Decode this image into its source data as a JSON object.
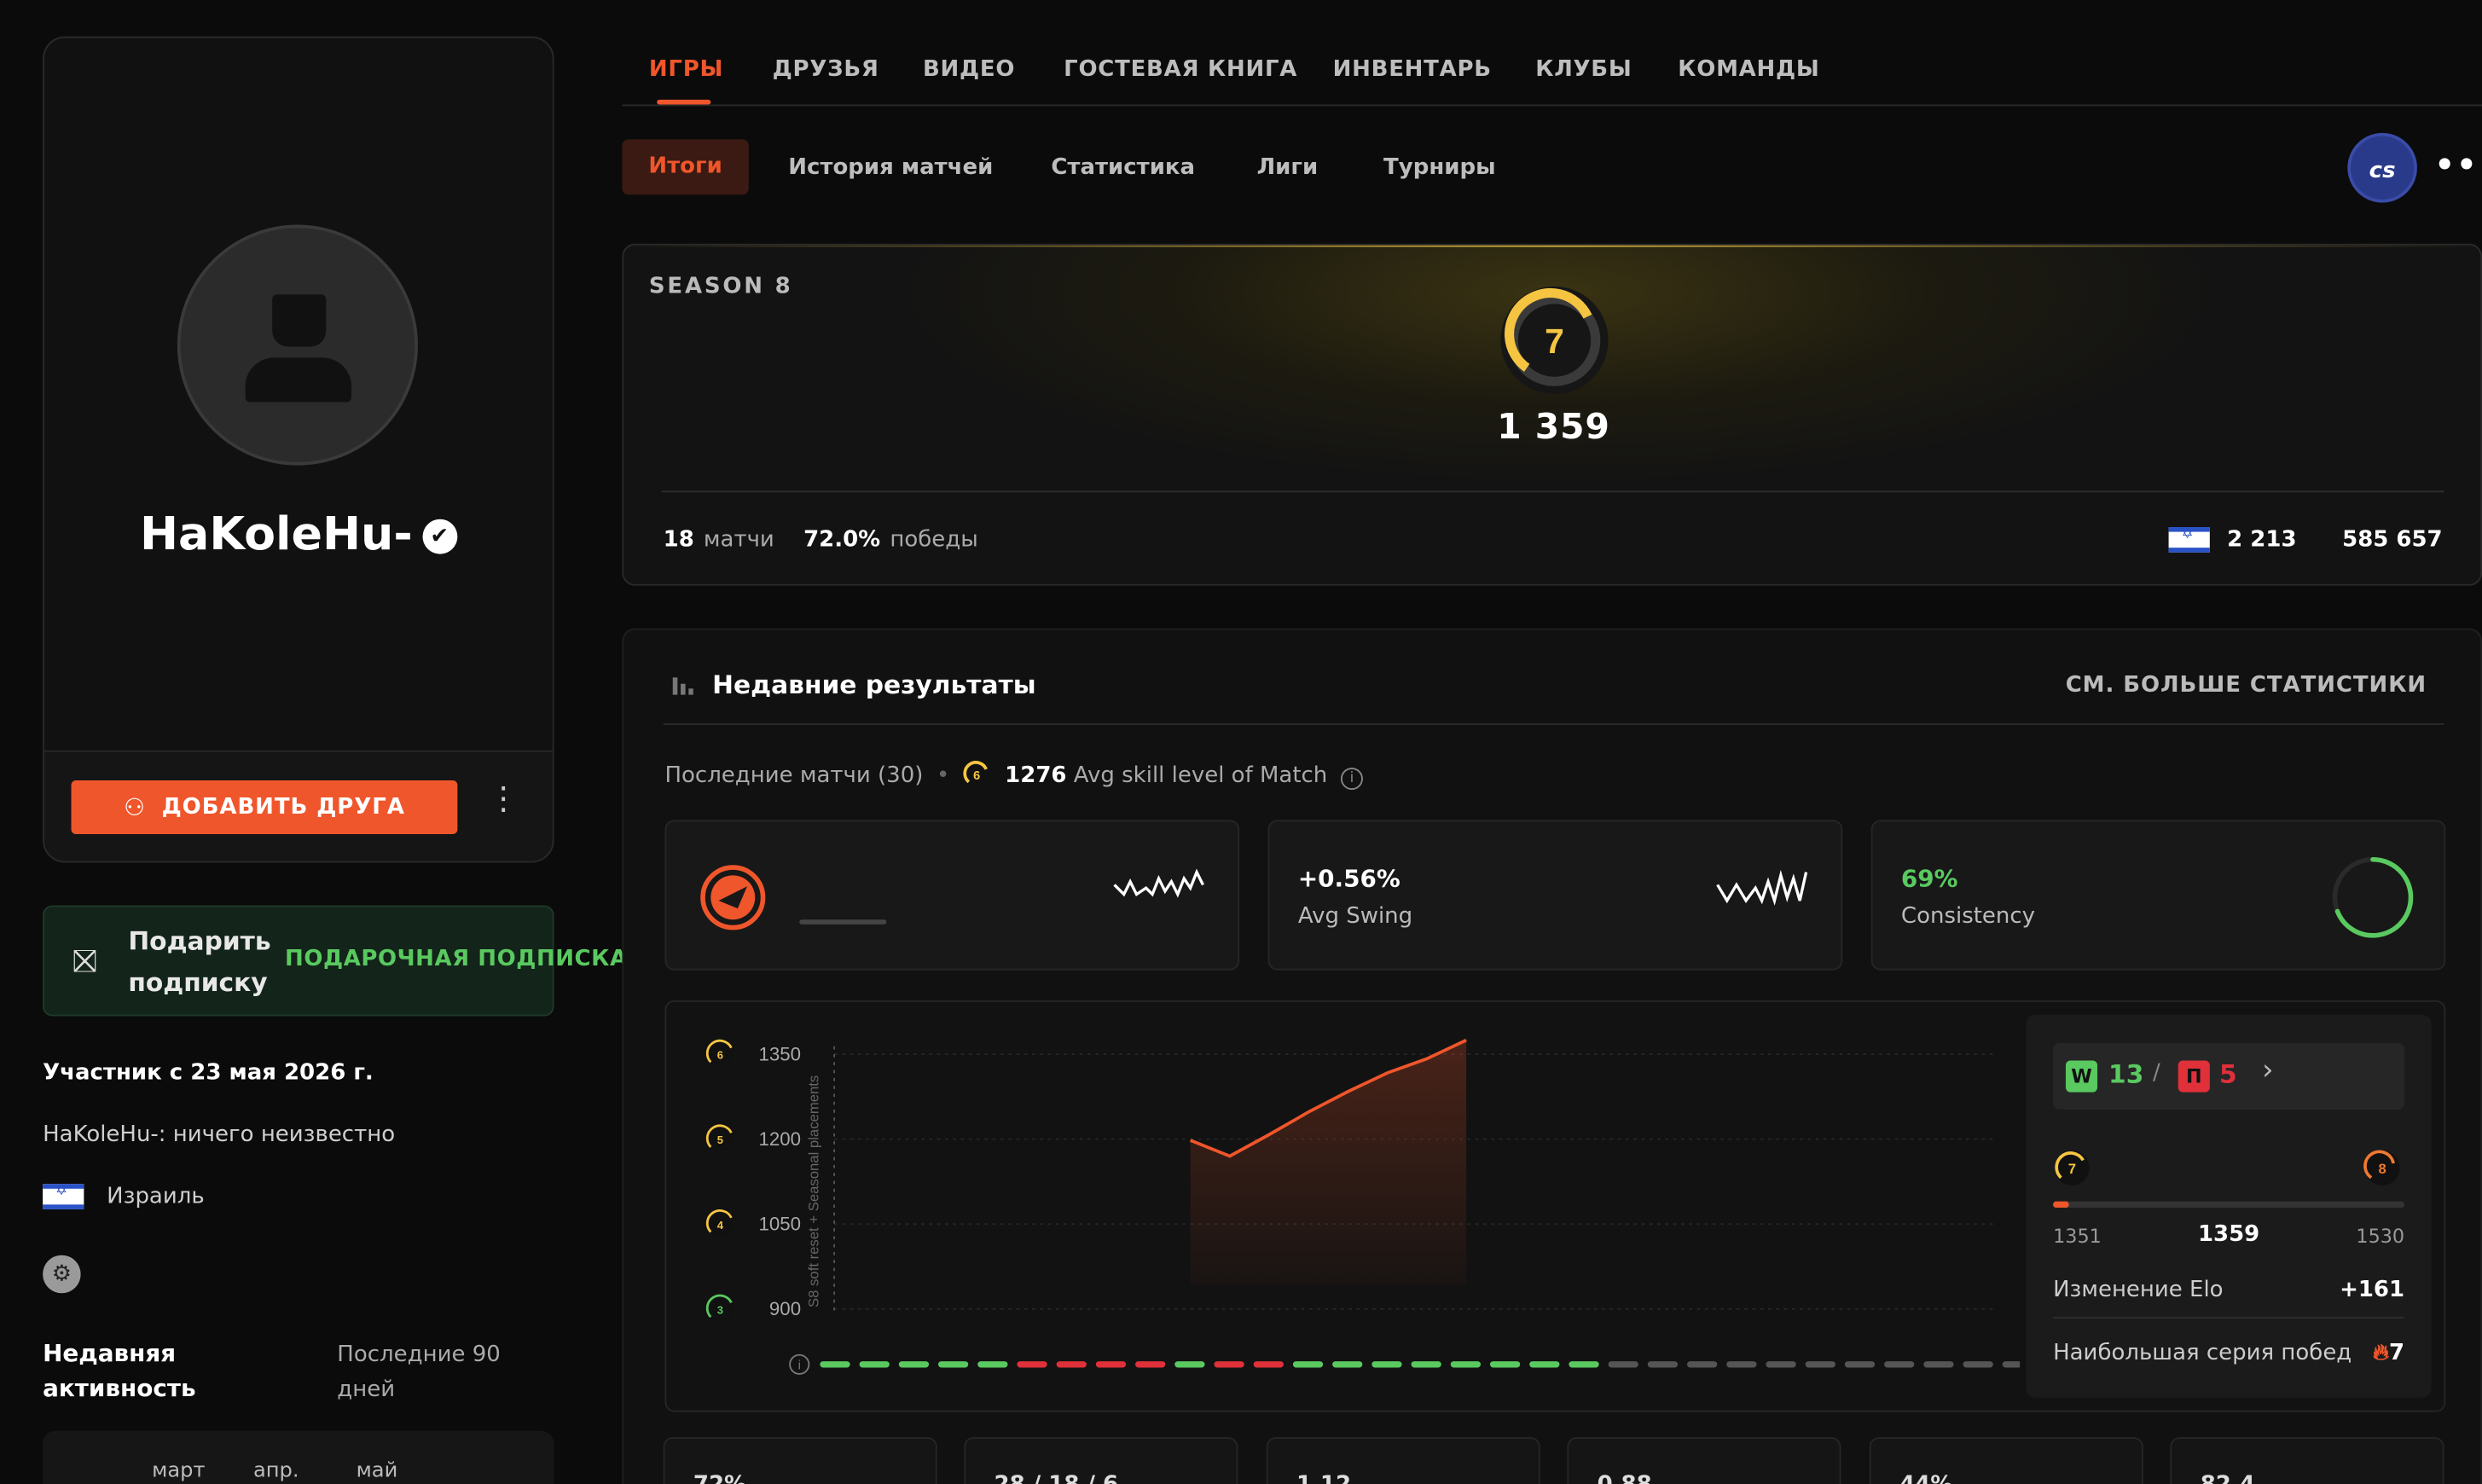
{
  "profile": {
    "nickname": "HaKoleHu-",
    "add_friend": "ДОБАВИТЬ ДРУГА",
    "gift_title": "Подарить подписку",
    "gift_link": "ПОДАРОЧНАЯ ПОДПИСКА",
    "member_since": "Участник с 23 мая 2026 г.",
    "about": "HaKoleHu-: ничего неизвестно",
    "country": "Израиль",
    "activity_title": "Недавняя активность",
    "activity_period": "Последние 90 дней",
    "calendar_months": [
      "март",
      "апр.",
      "май"
    ]
  },
  "nav": {
    "tabs": [
      "ИГРЫ",
      "ДРУЗЬЯ",
      "ВИДЕО",
      "ГОСТЕВАЯ КНИГА",
      "ИНВЕНТАРЬ",
      "КЛУБЫ",
      "КОМАНДЫ"
    ],
    "subtabs": [
      "Итоги",
      "История матчей",
      "Статистика",
      "Лиги",
      "Турниры"
    ],
    "game_label": "cs"
  },
  "season": {
    "label": "SEASON 8",
    "level": "7",
    "elo": "1 359",
    "matches_count": "18",
    "matches_label": "матчи",
    "winrate": "72.0%",
    "winrate_label": "победы",
    "country_rank": "2 213",
    "global_rank": "585 657"
  },
  "recent": {
    "title": "Недавние результаты",
    "more_link": "СМ. БОЛЬШЕ СТАТИСТИКИ",
    "last_matches": "Последние матчи (30)",
    "avg_level": "6",
    "avg_skill_value": "1276",
    "avg_skill_label": "Avg skill level of Match",
    "swing_value": "+0.56%",
    "swing_label": "Avg Swing",
    "consistency_value": "69%",
    "consistency_label": "Consistency",
    "wins": "13",
    "losses": "5",
    "win_letter": "W",
    "loss_letter": "П",
    "level_from": "7",
    "level_to": "8",
    "range_min": "1351",
    "range_current": "1359",
    "range_max": "1530",
    "elo_change_label": "Изменение Elo",
    "elo_change_value": "+161",
    "streak_label": "Наибольшая серия побед",
    "streak_value": "7",
    "reset_note": "S8 soft reset + Seasonal placements",
    "bottom_tiles": [
      "72%",
      "28 / 18 / 6",
      "1.12",
      "0.88",
      "44%",
      "82.4"
    ]
  },
  "colors": {
    "accent": "#f0562b",
    "win": "#59c960",
    "loss": "#e0303a",
    "level_gold": "#f5c542"
  },
  "chart_data": {
    "type": "line",
    "y_ticks": [
      1350,
      1200,
      1050,
      900
    ],
    "y_level_badges": [
      "6",
      "5",
      "4",
      "3"
    ],
    "ylim": [
      900,
      1350
    ],
    "x": [
      1,
      2,
      3,
      4,
      5,
      6,
      7,
      8
    ],
    "values": [
      1198,
      1170,
      1208,
      1248,
      1284,
      1317,
      1342,
      1375
    ],
    "results": [
      "W",
      "W",
      "W",
      "W",
      "W",
      "L",
      "L",
      "L",
      "L",
      "W",
      "L",
      "L",
      "W",
      "W",
      "W",
      "W",
      "W",
      "W",
      "W",
      "W",
      "N",
      "N",
      "N",
      "N",
      "N",
      "N",
      "N",
      "N",
      "N",
      "N",
      "N",
      "N"
    ]
  }
}
